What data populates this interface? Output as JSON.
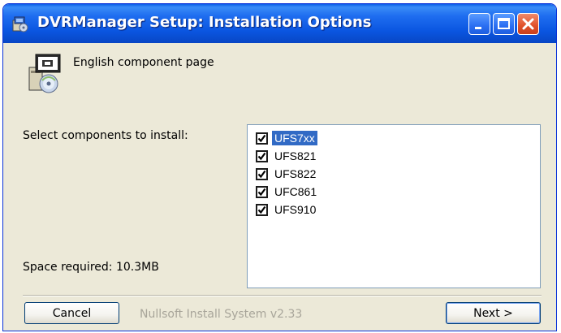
{
  "window": {
    "title": "DVRManager Setup: Installation Options"
  },
  "header": {
    "text": "English component page",
    "icon": "installer-disk-icon"
  },
  "components": {
    "label": "Select components to install:",
    "items": [
      {
        "label": "UFS7xx",
        "checked": true,
        "selected": true
      },
      {
        "label": "UFS821",
        "checked": true,
        "selected": false
      },
      {
        "label": "UFS822",
        "checked": true,
        "selected": false
      },
      {
        "label": "UFC861",
        "checked": true,
        "selected": false
      },
      {
        "label": "UFS910",
        "checked": true,
        "selected": false
      }
    ]
  },
  "space": {
    "label": "Space required: 10.3MB"
  },
  "footer": {
    "branding": "Nullsoft Install System v2.33",
    "cancel_label": "Cancel",
    "next_label": "Next >"
  },
  "colors": {
    "titlebar": "#0a55e0",
    "selection": "#316ac5",
    "dialog_bg": "#ece9d8"
  }
}
